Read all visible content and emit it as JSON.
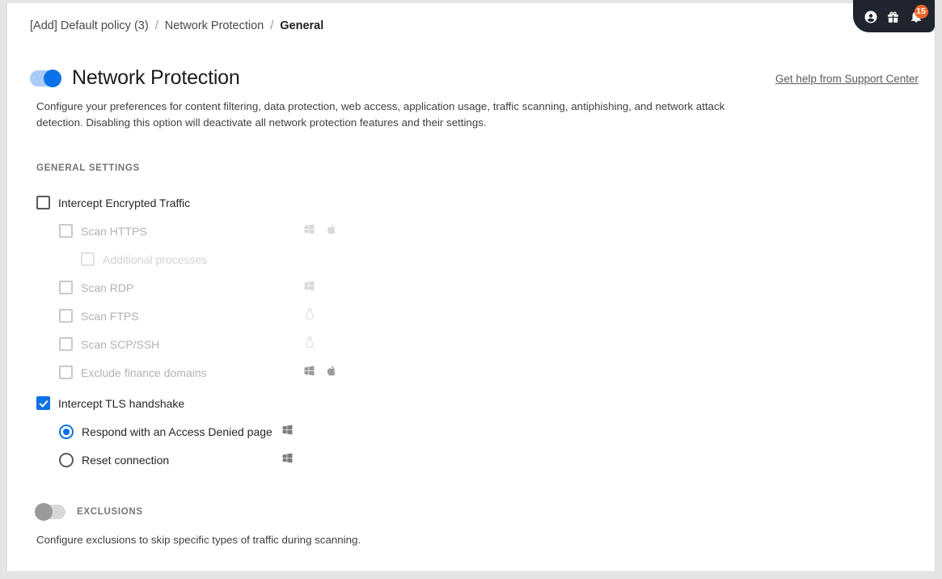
{
  "breadcrumb": {
    "items": [
      {
        "label": "[Add] Default policy (3)",
        "current": false
      },
      {
        "label": "Network Protection",
        "current": false
      },
      {
        "label": "General",
        "current": true
      }
    ],
    "separator": "/"
  },
  "account_bar": {
    "profile_icon": "user-circle-icon",
    "gift_icon": "gift-icon",
    "bell_icon": "bell-icon",
    "notification_count": "15",
    "badge_color": "#f2682a",
    "background_color": "#20242e"
  },
  "header": {
    "title": "Network Protection",
    "toggle_state": "on",
    "toggle_accent": "#0b72e7",
    "description": "Configure your preferences for content filtering, data protection, web access, application usage, traffic scanning, antiphishing, and network attack detection. Disabling this option will deactivate all network protection features and their settings.",
    "support_link": "Get help from Support Center"
  },
  "general_settings": {
    "section_label": "GENERAL SETTINGS",
    "options": [
      {
        "label": "Intercept Encrypted Traffic",
        "control": "checkbox",
        "checked": false,
        "enabled": true,
        "indent": 0,
        "platforms": []
      },
      {
        "label": "Scan HTTPS",
        "control": "checkbox",
        "checked": false,
        "enabled": false,
        "indent": 1,
        "platforms": [
          "windows-icon",
          "apple-icon"
        ]
      },
      {
        "label": "Additional processes",
        "control": "checkbox",
        "checked": false,
        "enabled": false,
        "indent": 2,
        "platforms": []
      },
      {
        "label": "Scan RDP",
        "control": "checkbox",
        "checked": false,
        "enabled": false,
        "indent": 1,
        "platforms": [
          "windows-icon"
        ]
      },
      {
        "label": "Scan FTPS",
        "control": "checkbox",
        "checked": false,
        "enabled": false,
        "indent": 1,
        "platforms": [
          "linux-icon"
        ]
      },
      {
        "label": "Scan SCP/SSH",
        "control": "checkbox",
        "checked": false,
        "enabled": false,
        "indent": 1,
        "platforms": [
          "linux-icon"
        ]
      },
      {
        "label": "Exclude finance domains",
        "control": "checkbox",
        "checked": false,
        "enabled": false,
        "indent": 1,
        "platforms": [
          "windows-icon",
          "apple-icon"
        ]
      },
      {
        "label": "Intercept TLS handshake",
        "control": "checkbox",
        "checked": true,
        "enabled": true,
        "indent": 0,
        "platforms": []
      },
      {
        "label": "Respond with an Access Denied page",
        "control": "radio",
        "checked": true,
        "enabled": true,
        "indent": 1,
        "platforms": [
          "windows-icon"
        ]
      },
      {
        "label": "Reset connection",
        "control": "radio",
        "checked": false,
        "enabled": true,
        "indent": 1,
        "platforms": [
          "windows-icon"
        ]
      }
    ]
  },
  "exclusions": {
    "label": "EXCLUSIONS",
    "toggle_state": "off",
    "description": "Configure exclusions to skip specific types of traffic during scanning."
  }
}
